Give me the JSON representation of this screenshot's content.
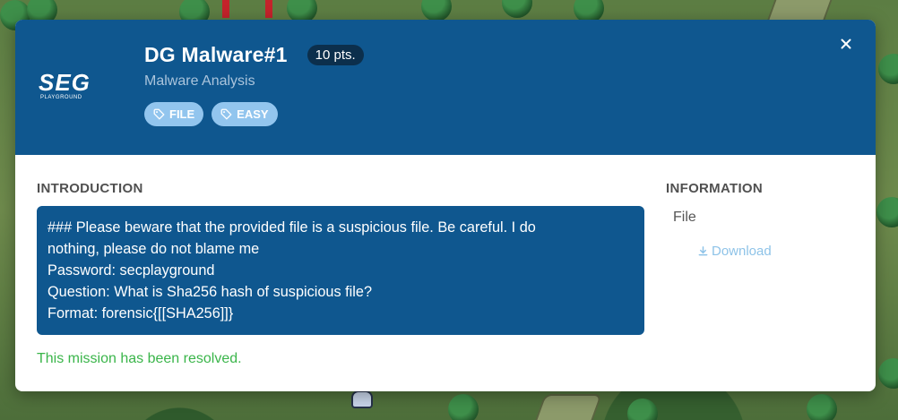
{
  "challenge": {
    "title": "DG Malware#1",
    "points": "10 pts.",
    "category": "Malware Analysis",
    "tags": [
      "FILE",
      "EASY"
    ],
    "logo_text": "SEG",
    "logo_subtext": "PLAYGROUND"
  },
  "introduction": {
    "heading": "INTRODUCTION",
    "lines": [
      "### Please beware that the provided file is a suspicious file. Be careful. I do",
      "nothing, please do not blame me",
      "Password: secplayground",
      "Question: What is Sha256 hash of suspicious file?",
      "Format: forensic{[[SHA256]]}"
    ],
    "status": "This mission has been resolved."
  },
  "information": {
    "heading": "INFORMATION",
    "file_label": "File",
    "download_label": "Download"
  },
  "icons": {
    "close": "close-icon",
    "tag": "tag-icon",
    "download": "download-icon"
  },
  "colors": {
    "header_bg": "#0f578f",
    "points_badge_bg": "#0c2f4c",
    "tag_bg": "#92c5ee",
    "resolved_text": "#3ab54a",
    "download_link": "#8ec3e8"
  }
}
